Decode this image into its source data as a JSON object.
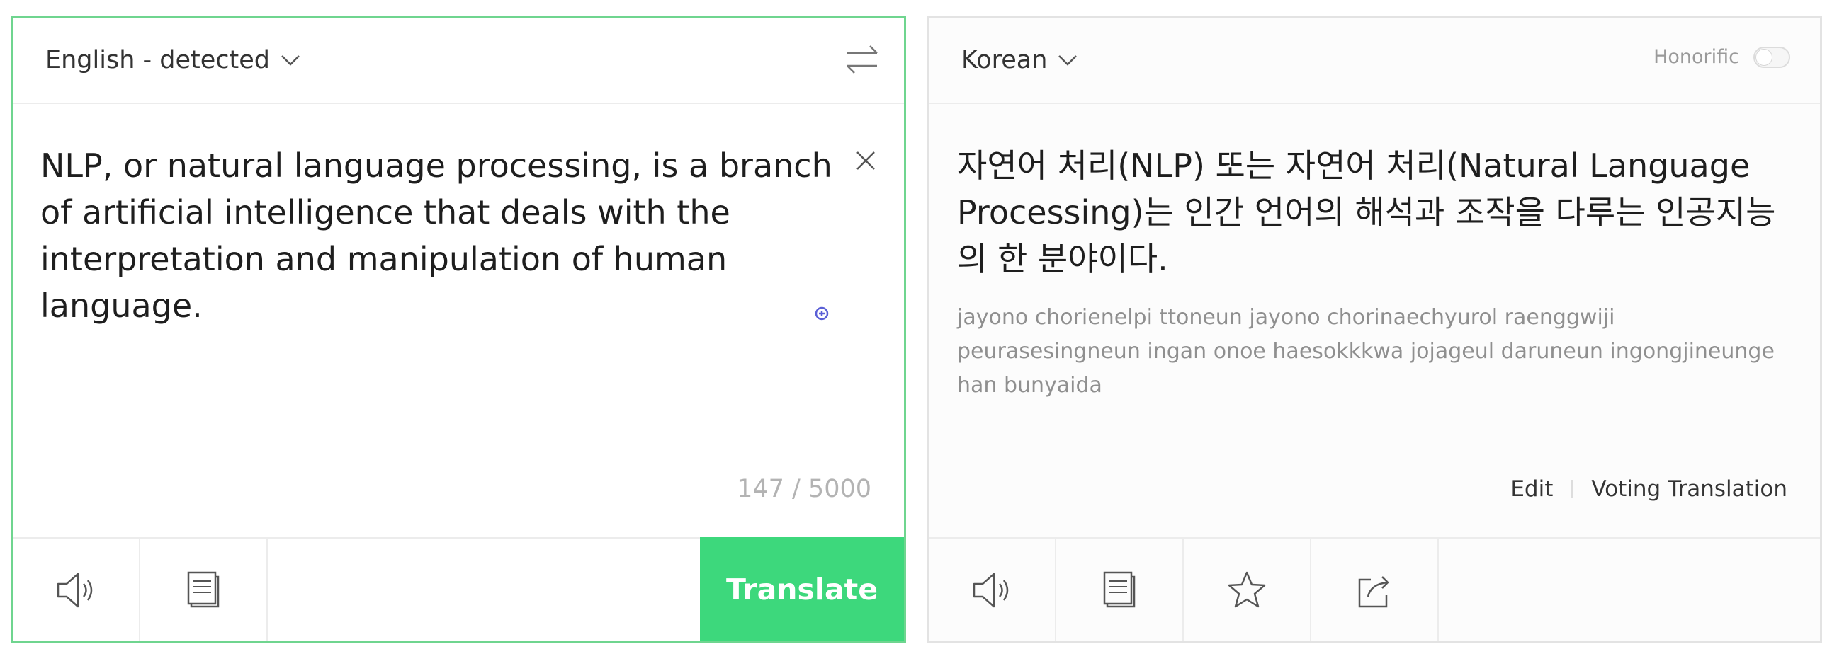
{
  "source": {
    "language_label": "English - detected",
    "text": "NLP, or natural language processing, is a branch of artificial intelligence that deals with the interpretation and manipulation of human language.",
    "char_count": "147 / 5000",
    "translate_label": "Translate"
  },
  "target": {
    "language_label": "Korean",
    "honorific_label": "Honorific",
    "honorific_on": false,
    "text": "자연어 처리(NLP) 또는 자연어 처리(Natural Language Processing)는 인간 언어의 해석과 조작을 다루는 인공지능의 한 분야이다.",
    "romanized": "jayono chorienelpi ttoneun jayono chorinaechyurol raenggwiji peurasesingneun ingan onoe haesokkkwa jojageul daruneun ingongjineunge han bunyaida",
    "edit_label": "Edit",
    "voting_label": "Voting Translation"
  },
  "icons": {
    "chevron": "chevron-down-icon",
    "swap": "swap-arrows-icon",
    "clear": "close-icon",
    "speaker": "speaker-icon",
    "copy": "copy-icon",
    "star": "star-icon",
    "share": "share-icon"
  },
  "colors": {
    "accent": "#3dd87c",
    "active_border": "#6fd58f",
    "muted_text": "#b3b3b3"
  }
}
